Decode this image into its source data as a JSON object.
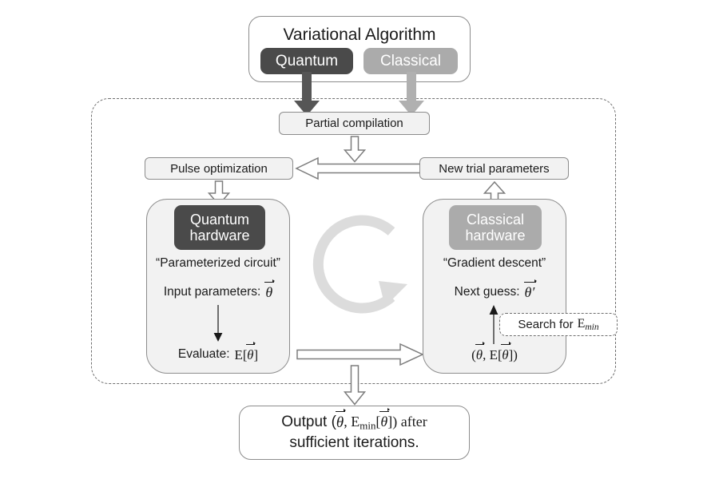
{
  "diagram": {
    "title": "Variational Algorithm hybrid quantum-classical loop",
    "colors": {
      "quantum": "#4a4a4a",
      "classical": "#ababab",
      "panel_fill": "#f2f2f2",
      "outline": "#8c8c8c",
      "dashed": "#6f6f6f",
      "loop_arrow": "#dcdcdc"
    }
  },
  "top": {
    "title": "Variational Algorithm",
    "quantum_chip": "Quantum",
    "classical_chip": "Classical"
  },
  "compilation": {
    "label": "Partial compilation"
  },
  "left_branch": {
    "stage_label": "Pulse optimization",
    "hardware_chip_line1": "Quantum",
    "hardware_chip_line2": "hardware",
    "quoted": "“Parameterized circuit”",
    "input_label": "Input parameters:",
    "input_symbol": "θ",
    "evaluate_label": "Evaluate:",
    "evaluate_symbol": "E[θ]"
  },
  "right_branch": {
    "stage_label": "New trial parameters",
    "hardware_chip_line1": "Classical",
    "hardware_chip_line2": "hardware",
    "quoted": "“Gradient descent”",
    "next_guess_label": "Next guess:",
    "next_guess_symbol": "θ′",
    "pair_label": "(θ, E[θ])",
    "search_label": "Search for",
    "search_symbol": "E",
    "search_subscript": "min"
  },
  "output": {
    "line1_prefix": "Output (",
    "line1_theta": "θ",
    "line1_mid": ", E",
    "line1_sub": "min",
    "line1_bracket_open": "[",
    "line1_theta2": "θ",
    "line1_bracket_close": "]) after",
    "line2": "sufficient iterations."
  },
  "icons": {
    "loop": "circular-refresh-arrow",
    "down_arrow": "hollow-down-arrow",
    "right_arrow": "hollow-right-arrow",
    "left_arrow": "hollow-left-arrow",
    "up_arrow": "hollow-up-arrow",
    "thin_down": "thin-down-arrow",
    "thin_up": "thin-up-arrow",
    "quantum_feed": "solid-dark-down-arrow",
    "classical_feed": "solid-light-down-arrow"
  }
}
